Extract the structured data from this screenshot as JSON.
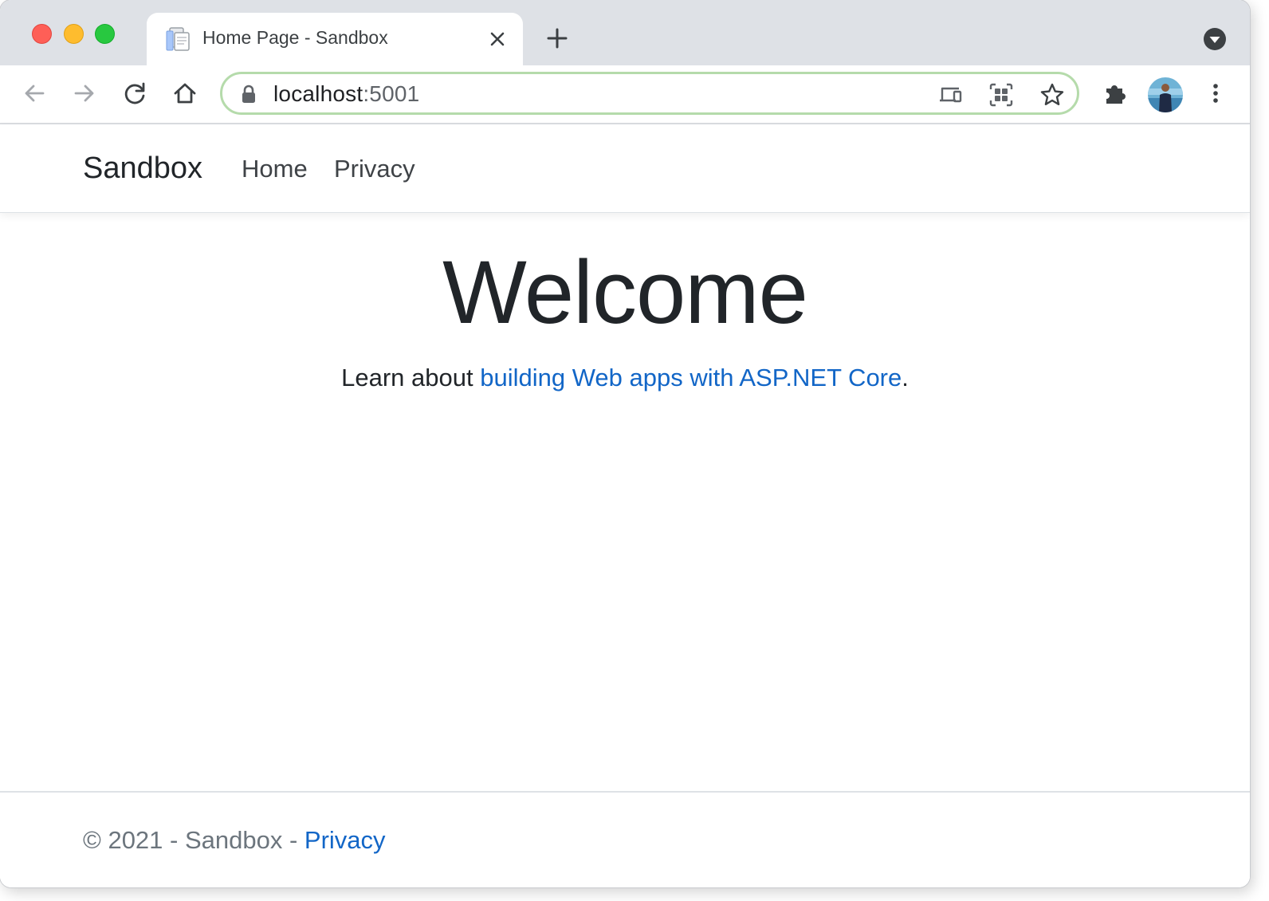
{
  "browser": {
    "tab": {
      "title": "Home Page - Sandbox",
      "favicon": "document-icon"
    },
    "new_tab_icon": "plus-icon",
    "tab_search_icon": "chevron-down-circle-icon",
    "toolbar": {
      "back_icon": "arrow-left-icon",
      "forward_icon": "arrow-right-icon",
      "reload_icon": "reload-icon",
      "home_icon": "home-icon",
      "address": {
        "host": "localhost",
        "port": ":5001",
        "lock_icon": "lock-icon"
      },
      "omnibox_icons": [
        "cast-devices-icon",
        "qr-grid-icon",
        "star-icon"
      ],
      "extensions_icon": "puzzle-icon",
      "menu_icon": "kebab-menu-icon"
    },
    "colors": {
      "omnibox_border": "#b5dbab",
      "tabstrip_bg": "#dee1e6"
    }
  },
  "site": {
    "brand": "Sandbox",
    "nav": [
      {
        "label": "Home"
      },
      {
        "label": "Privacy"
      }
    ],
    "heading": "Welcome",
    "lead": {
      "prefix": "Learn about ",
      "link": "building Web apps with ASP.NET Core",
      "suffix": "."
    },
    "footer": {
      "text": "© 2021 - Sandbox - ",
      "link": "Privacy"
    },
    "colors": {
      "link": "#1266c7",
      "text": "#212529",
      "muted": "#6c757d"
    }
  }
}
